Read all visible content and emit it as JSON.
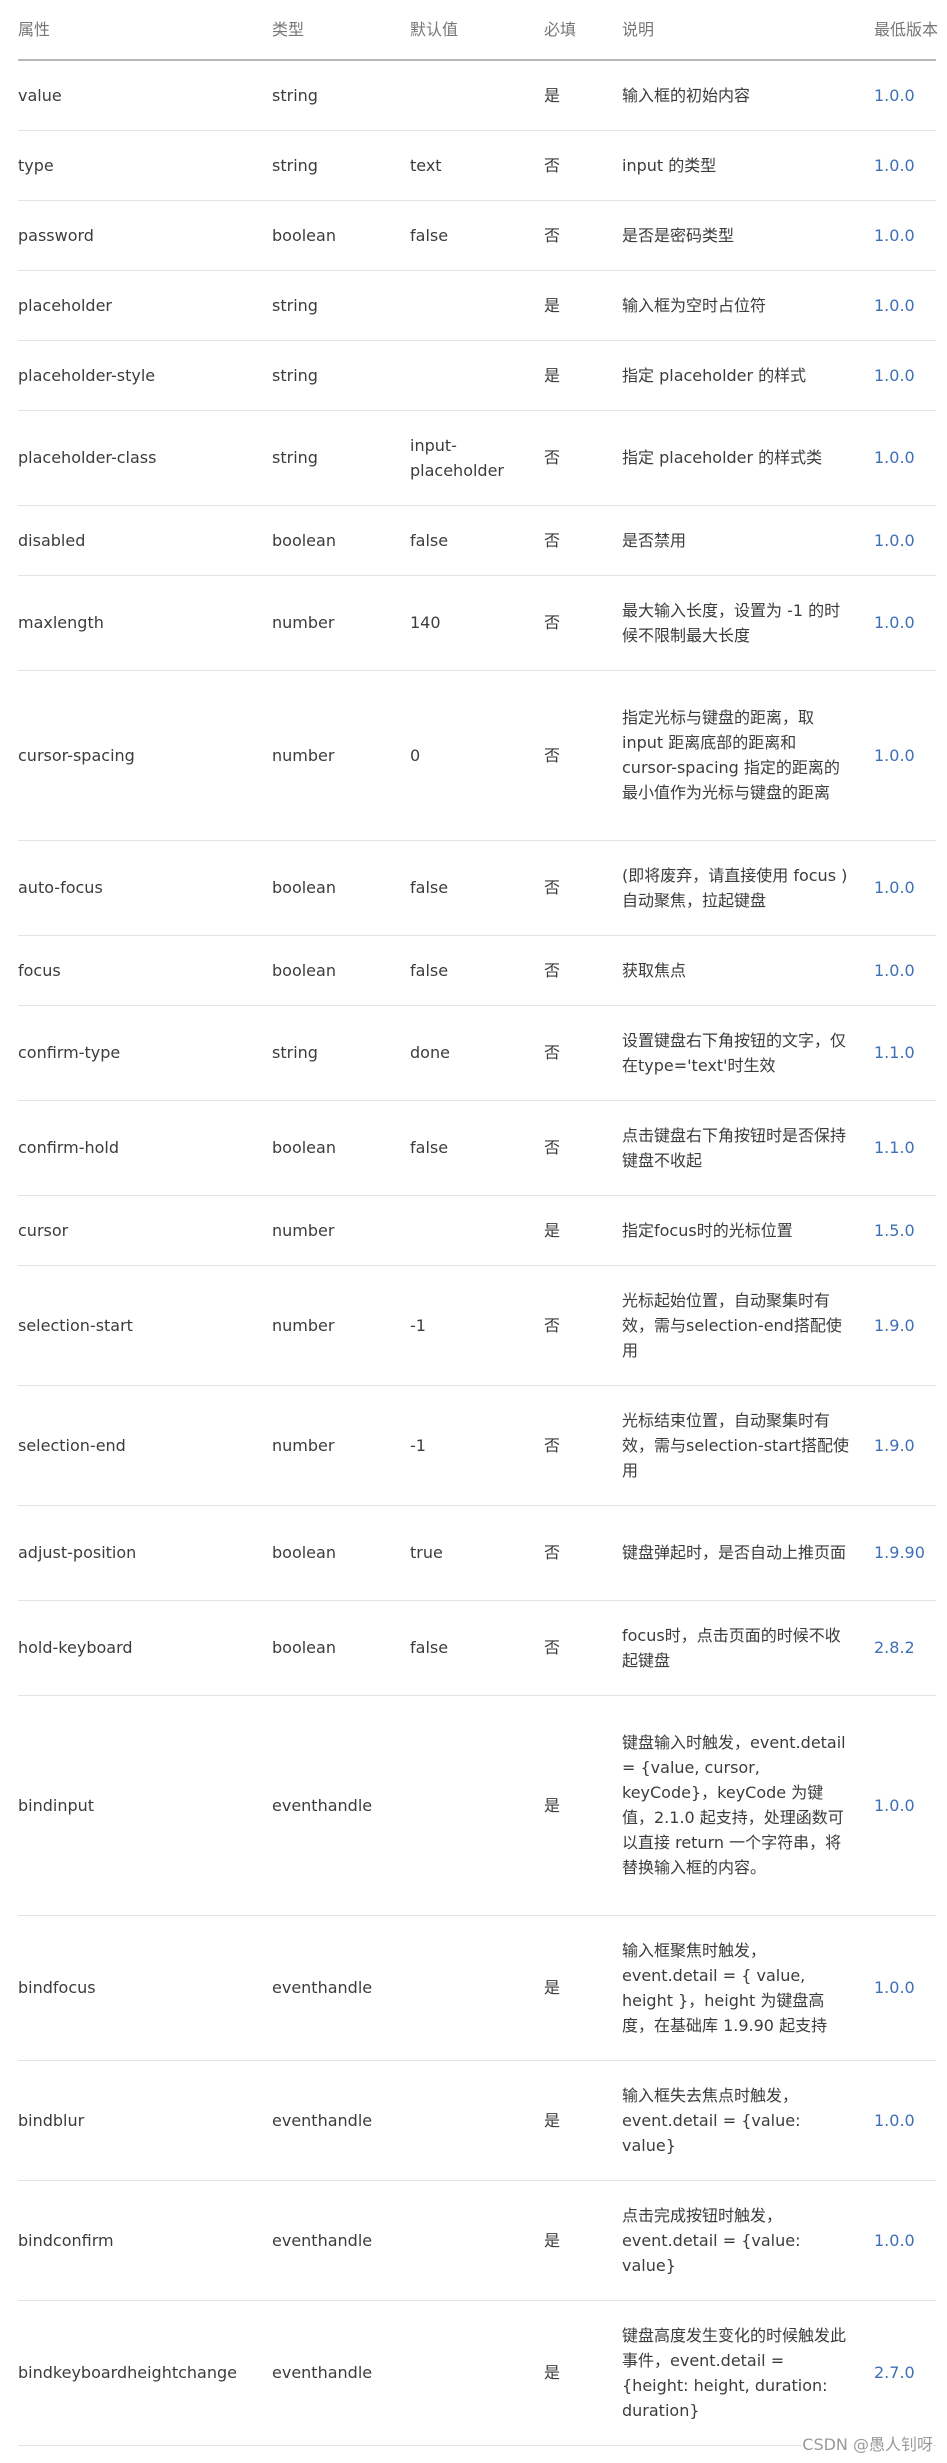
{
  "columns": [
    "属性",
    "类型",
    "默认值",
    "必填",
    "说明",
    "最低版本"
  ],
  "rows": [
    {
      "attr": "value",
      "type": "string",
      "default": "",
      "required": "是",
      "desc": "输入框的初始内容",
      "version": "1.0.0"
    },
    {
      "attr": "type",
      "type": "string",
      "default": "text",
      "required": "否",
      "desc": "input 的类型",
      "version": "1.0.0"
    },
    {
      "attr": "password",
      "type": "boolean",
      "default": "false",
      "required": "否",
      "desc": "是否是密码类型",
      "version": "1.0.0"
    },
    {
      "attr": "placeholder",
      "type": "string",
      "default": "",
      "required": "是",
      "desc": "输入框为空时占位符",
      "version": "1.0.0"
    },
    {
      "attr": "placeholder-style",
      "type": "string",
      "default": "",
      "required": "是",
      "desc": "指定 placeholder 的样式",
      "version": "1.0.0"
    },
    {
      "attr": "placeholder-class",
      "type": "string",
      "default": "input-placeholder",
      "required": "否",
      "desc": "指定 placeholder 的样式类",
      "version": "1.0.0"
    },
    {
      "attr": "disabled",
      "type": "boolean",
      "default": "false",
      "required": "否",
      "desc": "是否禁用",
      "version": "1.0.0"
    },
    {
      "attr": "maxlength",
      "type": "number",
      "default": "140",
      "required": "否",
      "desc": "最大输入长度，设置为 -1 的时候不限制最大长度",
      "version": "1.0.0"
    },
    {
      "attr": "cursor-spacing",
      "type": "number",
      "default": "0",
      "required": "否",
      "desc": "指定光标与键盘的距离，取 input 距离底部的距离和 cursor-spacing 指定的距离的最小值作为光标与键盘的距离",
      "version": "1.0.0"
    },
    {
      "attr": "auto-focus",
      "type": "boolean",
      "default": "false",
      "required": "否",
      "desc": "(即将废弃，请直接使用 focus )自动聚焦，拉起键盘",
      "version": "1.0.0"
    },
    {
      "attr": "focus",
      "type": "boolean",
      "default": "false",
      "required": "否",
      "desc": "获取焦点",
      "version": "1.0.0"
    },
    {
      "attr": "confirm-type",
      "type": "string",
      "default": "done",
      "required": "否",
      "desc": "设置键盘右下角按钮的文字，仅在type='text'时生效",
      "version": "1.1.0"
    },
    {
      "attr": "confirm-hold",
      "type": "boolean",
      "default": "false",
      "required": "否",
      "desc": "点击键盘右下角按钮时是否保持键盘不收起",
      "version": "1.1.0"
    },
    {
      "attr": "cursor",
      "type": "number",
      "default": "",
      "required": "是",
      "desc": "指定focus时的光标位置",
      "version": "1.5.0"
    },
    {
      "attr": "selection-start",
      "type": "number",
      "default": "-1",
      "required": "否",
      "desc": "光标起始位置，自动聚集时有效，需与selection-end搭配使用",
      "version": "1.9.0"
    },
    {
      "attr": "selection-end",
      "type": "number",
      "default": "-1",
      "required": "否",
      "desc": "光标结束位置，自动聚集时有效，需与selection-start搭配使用",
      "version": "1.9.0"
    },
    {
      "attr": "adjust-position",
      "type": "boolean",
      "default": "true",
      "required": "否",
      "desc": "键盘弹起时，是否自动上推页面",
      "version": "1.9.90"
    },
    {
      "attr": "hold-keyboard",
      "type": "boolean",
      "default": "false",
      "required": "否",
      "desc": "focus时，点击页面的时候不收起键盘",
      "version": "2.8.2"
    },
    {
      "attr": "bindinput",
      "type": "eventhandle",
      "default": "",
      "required": "是",
      "desc": "键盘输入时触发，event.detail = {value, cursor, keyCode}，keyCode 为键值，2.1.0 起支持，处理函数可以直接 return 一个字符串，将替换输入框的内容。",
      "version": "1.0.0"
    },
    {
      "attr": "bindfocus",
      "type": "eventhandle",
      "default": "",
      "required": "是",
      "desc": "输入框聚焦时触发，event.detail = { value, height }，height 为键盘高度，在基础库 1.9.90 起支持",
      "version": "1.0.0"
    },
    {
      "attr": "bindblur",
      "type": "eventhandle",
      "default": "",
      "required": "是",
      "desc": "输入框失去焦点时触发，event.detail = {value: value}",
      "version": "1.0.0"
    },
    {
      "attr": "bindconfirm",
      "type": "eventhandle",
      "default": "",
      "required": "是",
      "desc": "点击完成按钮时触发，event.detail = {value: value}",
      "version": "1.0.0"
    },
    {
      "attr": "bindkeyboardheightchange",
      "type": "eventhandle",
      "default": "",
      "required": "是",
      "desc": "键盘高度发生变化的时候触发此事件，event.detail = {height: height, duration: duration}",
      "version": "2.7.0"
    }
  ],
  "watermark": "CSDN @愚人钊呀"
}
